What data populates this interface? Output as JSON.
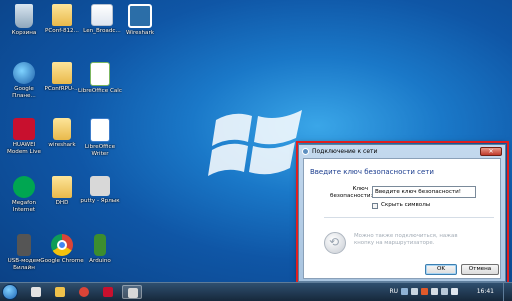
{
  "desktop": {
    "icons": [
      {
        "label": "Корзина"
      },
      {
        "label": "PConf-812..."
      },
      {
        "label": "Len_Broadc..."
      },
      {
        "label": "Wireshark"
      },
      {
        "label": "Google Плане..."
      },
      {
        "label": "PConfRPU-..."
      },
      {
        "label": "LibreOffice Calc"
      },
      {
        "label": "HUAWEI Modem Live"
      },
      {
        "label": "wireshark"
      },
      {
        "label": "LibreOffice Writer"
      },
      {
        "label": "Megafon Internet"
      },
      {
        "label": "DHD"
      },
      {
        "label": "putty - Ярлык"
      },
      {
        "label": "USB-модем Билайн"
      },
      {
        "label": "Google Chrome"
      },
      {
        "label": "Arduino"
      }
    ]
  },
  "dialog": {
    "title": "Подключение к сети",
    "close_glyph": "✕",
    "header": "Введите ключ безопасности сети",
    "key_label": "Ключ безопасности:",
    "key_value": "Введите ключ безопасности!",
    "hide_chars_label": "Скрыть символы",
    "wps_text": "Можно также подключиться, нажав кнопку на маршрутизаторе.",
    "ok_label": "OK",
    "cancel_label": "Отмена"
  },
  "taskbar": {
    "language": "RU",
    "clock": "16:41"
  },
  "colors": {
    "highlight": "#e01e1e",
    "dialog_header_text": "#1b3d8f"
  }
}
